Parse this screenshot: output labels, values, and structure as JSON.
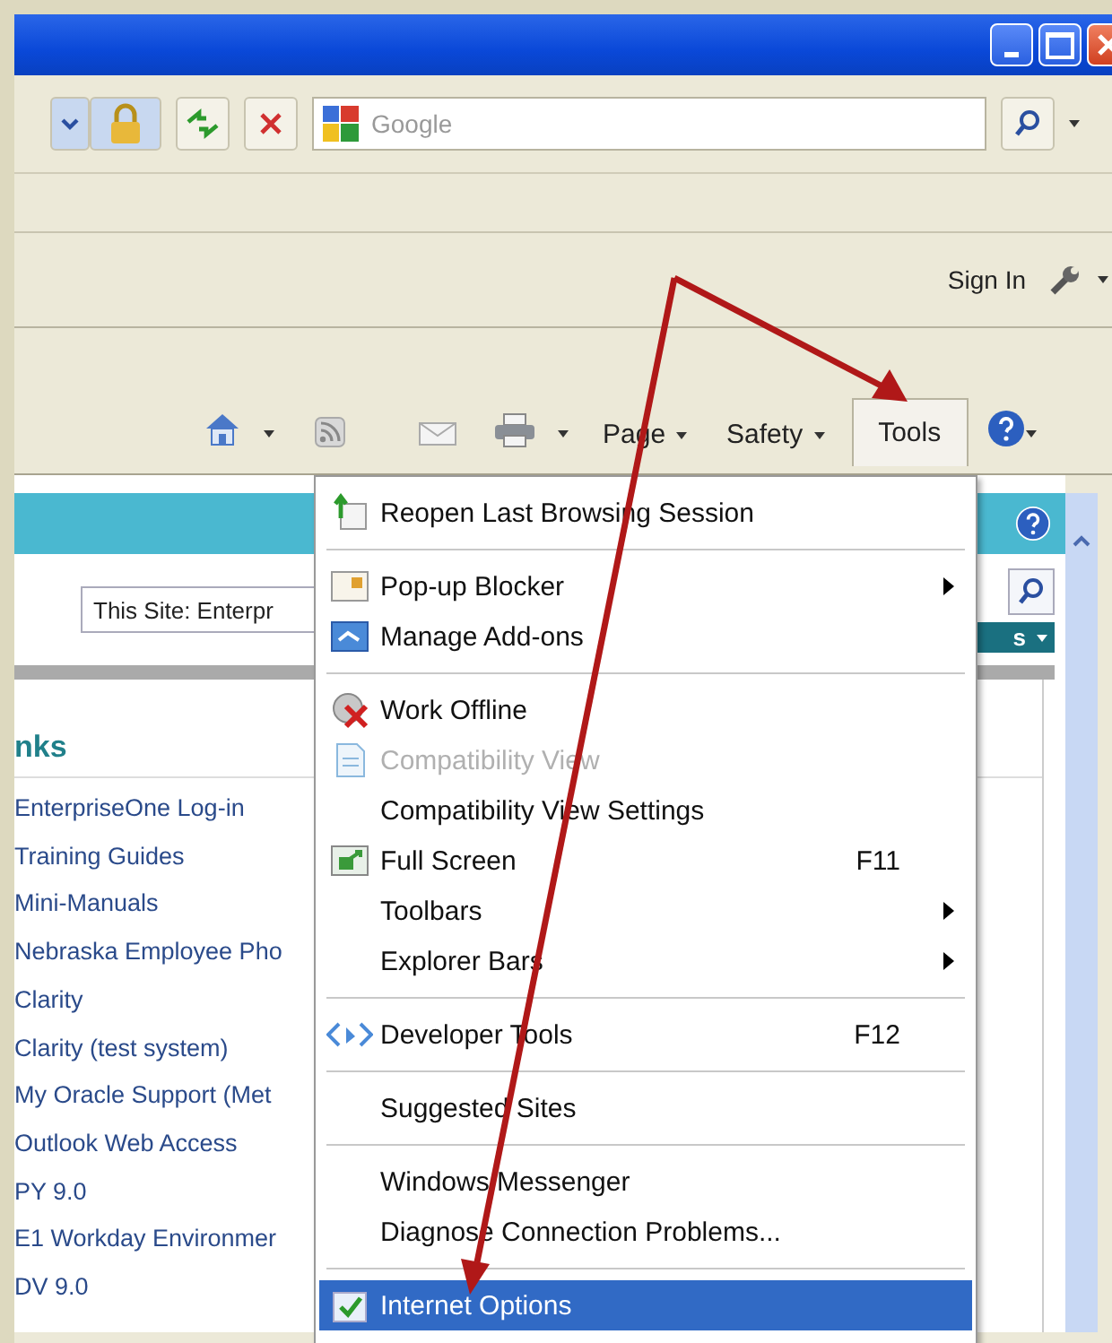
{
  "address_bar": {
    "search_placeholder": "Google"
  },
  "links_bar": {
    "sign_in": "Sign In"
  },
  "command_bar": {
    "buttons": [
      {
        "label": "Page",
        "selected": false,
        "dropdown": true
      },
      {
        "label": "Safety",
        "selected": false,
        "dropdown": true
      },
      {
        "label": "Tools",
        "selected": true,
        "dropdown": false
      }
    ]
  },
  "site": {
    "search_value": "This Site: Enterpr",
    "button_label": "s",
    "links_heading": "nks",
    "links": [
      "EnterpriseOne Log-in",
      "Training Guides",
      "Mini-Manuals",
      "Nebraska Employee Pho",
      "Clarity",
      "Clarity (test system)",
      "My Oracle Support (Met",
      "Outlook Web Access",
      "PY 9.0",
      "E1 Workday Environmer",
      "DV 9.0"
    ]
  },
  "tools_menu": {
    "groups": [
      {
        "items": [
          {
            "label": "Reopen Last Browsing Session",
            "submenu": false,
            "disabled": false,
            "selected": false
          }
        ]
      },
      {
        "items": [
          {
            "label": "Pop-up Blocker",
            "submenu": true,
            "disabled": false,
            "selected": false
          },
          {
            "label": "Manage Add-ons",
            "submenu": false,
            "disabled": false,
            "selected": false
          }
        ]
      },
      {
        "items": [
          {
            "label": "Work Offline",
            "submenu": false,
            "disabled": false,
            "selected": false
          },
          {
            "label": "Compatibility View",
            "submenu": false,
            "disabled": true,
            "selected": false
          },
          {
            "label": "Compatibility View Settings",
            "submenu": false,
            "disabled": false,
            "selected": false
          },
          {
            "label": "Full Screen",
            "shortcut": "F11",
            "submenu": false,
            "disabled": false,
            "selected": false
          },
          {
            "label": "Toolbars",
            "submenu": true,
            "disabled": false,
            "selected": false
          },
          {
            "label": "Explorer Bars",
            "submenu": true,
            "disabled": false,
            "selected": false
          }
        ]
      },
      {
        "items": [
          {
            "label": "Developer Tools",
            "shortcut": "F12",
            "submenu": false,
            "disabled": false,
            "selected": false
          }
        ]
      },
      {
        "items": [
          {
            "label": "Suggested Sites",
            "submenu": false,
            "disabled": false,
            "selected": false
          }
        ]
      },
      {
        "items": [
          {
            "label": "Windows Messenger",
            "submenu": false,
            "disabled": false,
            "selected": false
          },
          {
            "label": "Diagnose Connection Problems...",
            "submenu": false,
            "disabled": false,
            "selected": false
          }
        ]
      },
      {
        "items": [
          {
            "label": "Internet Options",
            "submenu": false,
            "disabled": false,
            "selected": true
          }
        ]
      }
    ]
  }
}
